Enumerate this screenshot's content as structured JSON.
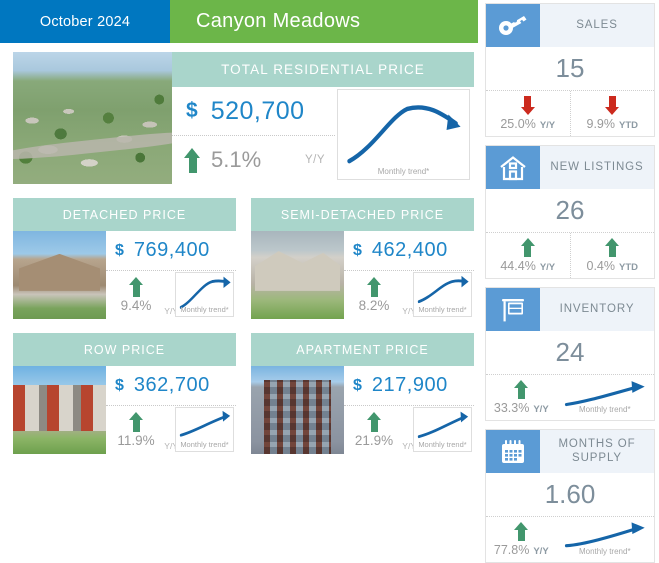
{
  "header": {
    "month": "October 2024",
    "area": "Canyon Meadows"
  },
  "hero": {
    "title": "TOTAL RESIDENTIAL PRICE",
    "currency": "$",
    "price": "520,700",
    "pct": "5.1%",
    "pct_label": "Y/Y",
    "trend_label": "Monthly trend*",
    "photo": "aerial-suburban-neighbourhood-photo"
  },
  "cards": [
    {
      "title": "DETACHED PRICE",
      "currency": "$",
      "price": "769,400",
      "pct": "9.4%",
      "pct_label": "Y/Y",
      "trend_label": "Monthly trend*",
      "photo": "detached-house-photo",
      "photo_class": "ph-detached",
      "direction": "up"
    },
    {
      "title": "SEMI-DETACHED PRICE",
      "currency": "$",
      "price": "462,400",
      "pct": "8.2%",
      "pct_label": "Y/Y",
      "trend_label": "Monthly trend*",
      "photo": "semi-detached-house-photo",
      "photo_class": "ph-semi",
      "direction": "up"
    },
    {
      "title": "ROW PRICE",
      "currency": "$",
      "price": "362,700",
      "pct": "11.9%",
      "pct_label": "Y/Y",
      "trend_label": "Monthly trend*",
      "photo": "row-townhouses-photo",
      "photo_class": "ph-row",
      "direction": "up"
    },
    {
      "title": "APARTMENT PRICE",
      "currency": "$",
      "price": "217,900",
      "pct": "21.9%",
      "pct_label": "Y/Y",
      "trend_label": "Monthly trend*",
      "photo": "apartment-tower-photo",
      "photo_class": "ph-apt",
      "direction": "up"
    }
  ],
  "sidebar": [
    {
      "title": "SALES",
      "icon": "keys-icon",
      "value": "15",
      "stats": [
        {
          "pct": "25.0%",
          "label": "Y/Y",
          "direction": "down"
        },
        {
          "pct": "9.9%",
          "label": "YTD",
          "direction": "down"
        }
      ],
      "has_trend": false
    },
    {
      "title": "NEW LISTINGS",
      "icon": "house-icon",
      "value": "26",
      "stats": [
        {
          "pct": "44.4%",
          "label": "Y/Y",
          "direction": "up"
        },
        {
          "pct": "0.4%",
          "label": "YTD",
          "direction": "up"
        }
      ],
      "has_trend": false
    },
    {
      "title": "INVENTORY",
      "icon": "for-sale-sign-icon",
      "value": "24",
      "stats": [
        {
          "pct": "33.3%",
          "label": "Y/Y",
          "direction": "up"
        }
      ],
      "has_trend": true,
      "trend_label": "Monthly trend*"
    },
    {
      "title": "MONTHS OF SUPPLY",
      "icon": "calendar-icon",
      "value": "1.60",
      "stats": [
        {
          "pct": "77.8%",
          "label": "Y/Y",
          "direction": "up"
        }
      ],
      "has_trend": true,
      "trend_label": "Monthly trend*"
    }
  ],
  "colors": {
    "header_blue": "#0077c0",
    "header_green": "#6cb649",
    "band_teal": "#a9d5cb",
    "price_blue": "#1f86c8",
    "up_green": "#42966d",
    "down_red": "#cc2a1e",
    "icon_blue": "#5b9bd5",
    "trend_blue": "#1565a8"
  }
}
